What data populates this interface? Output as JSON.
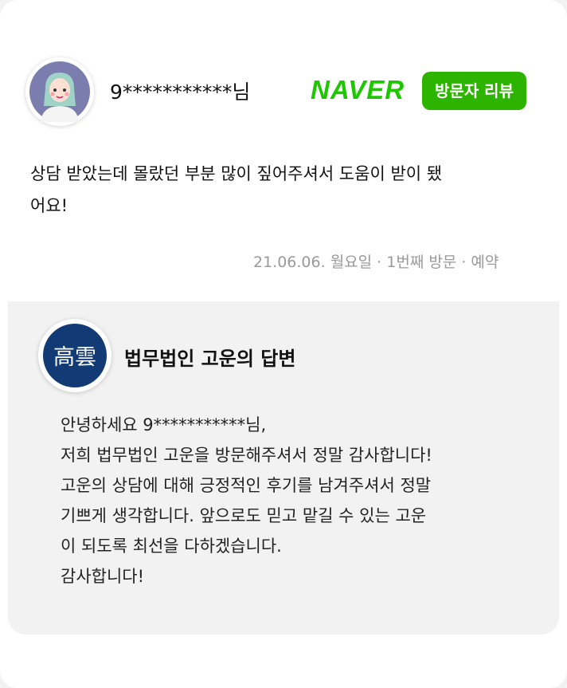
{
  "review": {
    "username": "9***********님",
    "platform_logo": "NAVER",
    "badge": "방문자 리뷰",
    "text_lines": [
      "상담 받았는데 몰랐던 부분 많이 짚어주셔서 도움이 받이 됐",
      "어요!"
    ],
    "meta": "21.06.06. 월요일 · 1번째 방문 · 예약",
    "brand_color": "#1ec800",
    "avatar_icon": "user-avatar-icon"
  },
  "reply": {
    "title": "법무법인 고운의 답변",
    "logo_icon": "law-firm-logo-icon",
    "logo_text": "高雲",
    "logo_color": "#123a75",
    "body_lines": [
      "안녕하세요 9***********님,",
      "저희 법무법인 고운을 방문해주셔서 정말 감사합니다!",
      "고운의 상담에 대해 긍정적인 후기를 남겨주셔서 정말",
      "기쁘게 생각합니다. 앞으로도 믿고 맡길 수 있는 고운",
      "이 되도록 최선을 다하겠습니다.",
      "감사합니다!"
    ]
  }
}
